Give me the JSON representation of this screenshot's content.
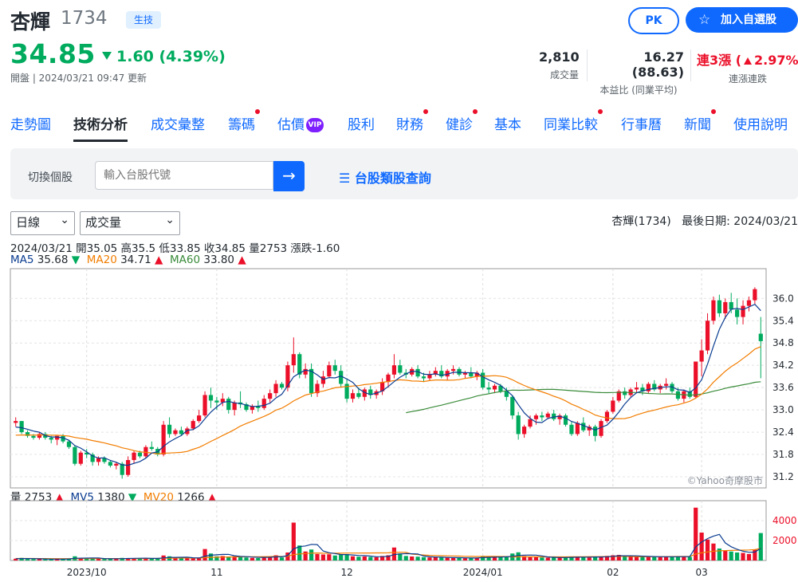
{
  "header": {
    "name": "杏輝",
    "code": "1734",
    "industry": "生技",
    "price": "34.85",
    "change": "1.60 (4.39%)",
    "market_time": "開盤 | 2024/03/21 09:47 更新",
    "pk_label": "PK",
    "watchlist_label": "加入自選股"
  },
  "stats": [
    {
      "value": "2,810",
      "label": "成交量"
    },
    {
      "value": "16.27 (88.63)",
      "label": "本益比 (同業平均)"
    },
    {
      "value_prefix": "連3漲 (",
      "value_pct": "2.97%)",
      "label": "連漲連跌"
    }
  ],
  "tabs": [
    {
      "label": "走勢圖"
    },
    {
      "label": "技術分析",
      "active": true
    },
    {
      "label": "成交彙整"
    },
    {
      "label": "籌碼",
      "dot": true
    },
    {
      "label": "估價",
      "vip": "VIP"
    },
    {
      "label": "股利"
    },
    {
      "label": "財務",
      "dot": true
    },
    {
      "label": "健診",
      "dot": true
    },
    {
      "label": "基本"
    },
    {
      "label": "同業比較",
      "dot": true
    },
    {
      "label": "行事曆"
    },
    {
      "label": "新聞",
      "dot": true
    },
    {
      "label": "使用說明"
    }
  ],
  "switcher": {
    "label": "切換個股",
    "placeholder": "輸入台股代號",
    "category_link": "台股類股查詢"
  },
  "controls": {
    "period": "日線",
    "indicator": "成交量",
    "stock_label": "杏輝(1734)",
    "last_date_label": "最後日期: 2024/03/21"
  },
  "ohlc_line": "2024/03/21 開35.05 高35.5 低33.85 收34.85 量2753 漲跌-1.60",
  "ma": {
    "ma5_label": "MA5",
    "ma5_value": "35.68",
    "ma20_label": "MA20",
    "ma20_value": "34.71",
    "ma60_label": "MA60",
    "ma60_value": "33.80"
  },
  "vol_legend": {
    "vol_label": "量",
    "vol_value": "2753",
    "mv5_label": "MV5",
    "mv5_value": "1380",
    "mv20_label": "MV20",
    "mv20_value": "1266"
  },
  "watermark": "©Yahoo奇摩股市",
  "colors": {
    "up": "#eb0f29",
    "down": "#00ab5e",
    "accent": "#0f69ff",
    "ma5": "#0b3d91",
    "ma20": "#f27d00",
    "ma60": "#3a8b3a"
  },
  "chart_data": {
    "type": "candlestick",
    "price_axis_ticks": [
      36.0,
      35.4,
      34.8,
      34.2,
      33.6,
      33.0,
      32.4,
      31.8,
      31.2
    ],
    "volume_axis_ticks": [
      4000,
      2000
    ],
    "x_labels": [
      "2023/10",
      "11",
      "12",
      "2024/01",
      "02",
      "03"
    ],
    "ylim": [
      30.9,
      36.8
    ],
    "vol_ylim": [
      0,
      6000
    ],
    "candles": [
      [
        32.65,
        32.8,
        32.55,
        32.7,
        180
      ],
      [
        32.7,
        32.7,
        32.35,
        32.4,
        260
      ],
      [
        32.4,
        32.45,
        32.25,
        32.3,
        150
      ],
      [
        32.3,
        32.35,
        32.2,
        32.25,
        140
      ],
      [
        32.25,
        32.4,
        32.2,
        32.35,
        120
      ],
      [
        32.35,
        32.4,
        32.2,
        32.25,
        110
      ],
      [
        32.25,
        32.3,
        32.1,
        32.2,
        160
      ],
      [
        32.2,
        32.3,
        32.05,
        32.3,
        140
      ],
      [
        32.3,
        32.35,
        32.1,
        32.15,
        150
      ],
      [
        32.15,
        32.2,
        31.95,
        32.0,
        200
      ],
      [
        32.0,
        32.05,
        31.5,
        31.55,
        420
      ],
      [
        31.55,
        31.9,
        31.5,
        31.85,
        260
      ],
      [
        31.85,
        31.95,
        31.7,
        31.8,
        180
      ],
      [
        31.8,
        31.85,
        31.5,
        31.6,
        220
      ],
      [
        31.6,
        31.75,
        31.5,
        31.7,
        160
      ],
      [
        31.7,
        31.75,
        31.55,
        31.6,
        150
      ],
      [
        31.6,
        31.65,
        31.45,
        31.5,
        170
      ],
      [
        31.5,
        31.6,
        31.4,
        31.55,
        190
      ],
      [
        31.55,
        31.6,
        31.15,
        31.25,
        260
      ],
      [
        31.25,
        31.75,
        31.2,
        31.65,
        240
      ],
      [
        31.65,
        31.9,
        31.55,
        31.85,
        230
      ],
      [
        31.85,
        31.9,
        31.7,
        31.75,
        200
      ],
      [
        31.75,
        32.05,
        31.7,
        32.0,
        210
      ],
      [
        32.0,
        32.15,
        31.9,
        31.95,
        180
      ],
      [
        31.95,
        32.0,
        31.75,
        31.8,
        200
      ],
      [
        31.8,
        32.7,
        31.75,
        32.6,
        500
      ],
      [
        32.6,
        32.8,
        32.25,
        32.35,
        420
      ],
      [
        32.35,
        32.5,
        32.3,
        32.45,
        260
      ],
      [
        32.45,
        32.55,
        32.3,
        32.35,
        230
      ],
      [
        32.35,
        32.55,
        32.3,
        32.5,
        220
      ],
      [
        32.5,
        32.75,
        32.45,
        32.7,
        250
      ],
      [
        32.7,
        33.0,
        32.65,
        32.85,
        300
      ],
      [
        32.85,
        33.5,
        32.8,
        33.4,
        1150
      ],
      [
        33.4,
        33.6,
        33.05,
        33.25,
        700
      ],
      [
        33.25,
        33.35,
        33.0,
        33.2,
        420
      ],
      [
        33.2,
        33.45,
        33.1,
        33.3,
        450
      ],
      [
        33.3,
        33.35,
        32.9,
        33.0,
        360
      ],
      [
        33.0,
        33.25,
        32.85,
        33.2,
        420
      ],
      [
        33.2,
        33.5,
        33.05,
        33.15,
        380
      ],
      [
        33.15,
        33.2,
        32.95,
        33.0,
        300
      ],
      [
        33.0,
        33.15,
        32.9,
        33.1,
        260
      ],
      [
        33.1,
        33.25,
        32.95,
        33.05,
        240
      ],
      [
        33.05,
        33.4,
        33.0,
        33.3,
        380
      ],
      [
        33.3,
        33.55,
        33.2,
        33.45,
        420
      ],
      [
        33.45,
        33.8,
        33.35,
        33.7,
        520
      ],
      [
        33.7,
        33.75,
        33.55,
        33.6,
        300
      ],
      [
        33.6,
        34.3,
        33.5,
        34.2,
        800
      ],
      [
        34.2,
        34.95,
        34.0,
        34.5,
        3800
      ],
      [
        34.5,
        34.55,
        33.85,
        33.95,
        1500
      ],
      [
        33.95,
        34.25,
        33.85,
        34.1,
        900
      ],
      [
        34.1,
        34.25,
        33.35,
        33.45,
        1100
      ],
      [
        33.45,
        33.8,
        33.35,
        33.7,
        650
      ],
      [
        33.7,
        34.05,
        33.6,
        33.9,
        600
      ],
      [
        33.9,
        34.3,
        33.85,
        34.2,
        620
      ],
      [
        34.2,
        34.35,
        33.95,
        34.05,
        500
      ],
      [
        34.05,
        34.2,
        33.6,
        33.7,
        580
      ],
      [
        33.7,
        33.85,
        33.2,
        33.3,
        640
      ],
      [
        33.3,
        33.55,
        33.2,
        33.45,
        420
      ],
      [
        33.45,
        33.6,
        33.3,
        33.35,
        380
      ],
      [
        33.35,
        33.6,
        33.25,
        33.55,
        400
      ],
      [
        33.55,
        33.65,
        33.3,
        33.4,
        350
      ],
      [
        33.4,
        33.55,
        33.3,
        33.5,
        330
      ],
      [
        33.5,
        33.85,
        33.4,
        33.75,
        450
      ],
      [
        33.75,
        34.0,
        33.6,
        33.95,
        520
      ],
      [
        33.95,
        34.5,
        33.85,
        34.2,
        1300
      ],
      [
        34.2,
        34.35,
        33.95,
        34.0,
        700
      ],
      [
        34.0,
        34.1,
        33.85,
        33.95,
        450
      ],
      [
        33.95,
        34.15,
        33.9,
        34.1,
        400
      ],
      [
        34.1,
        34.2,
        33.85,
        33.9,
        380
      ],
      [
        33.9,
        34.0,
        33.75,
        33.85,
        330
      ],
      [
        33.85,
        34.05,
        33.8,
        33.95,
        300
      ],
      [
        33.95,
        34.15,
        33.9,
        34.05,
        320
      ],
      [
        34.05,
        34.2,
        33.85,
        33.9,
        300
      ],
      [
        33.9,
        34.1,
        33.8,
        34.05,
        280
      ],
      [
        34.05,
        34.2,
        33.95,
        34.1,
        260
      ],
      [
        34.1,
        34.15,
        33.9,
        33.95,
        240
      ],
      [
        33.95,
        34.05,
        33.85,
        34.0,
        230
      ],
      [
        34.0,
        34.15,
        33.85,
        33.9,
        250
      ],
      [
        33.9,
        34.05,
        33.8,
        34.0,
        260
      ],
      [
        34.0,
        34.1,
        33.55,
        33.6,
        450
      ],
      [
        33.6,
        33.75,
        33.45,
        33.55,
        380
      ],
      [
        33.55,
        33.7,
        33.45,
        33.65,
        300
      ],
      [
        33.65,
        33.7,
        33.45,
        33.5,
        320
      ],
      [
        33.5,
        33.6,
        33.25,
        33.35,
        380
      ],
      [
        33.35,
        33.4,
        32.75,
        32.85,
        700
      ],
      [
        32.85,
        32.95,
        32.2,
        32.35,
        820
      ],
      [
        32.35,
        32.6,
        32.25,
        32.55,
        450
      ],
      [
        32.55,
        32.85,
        32.5,
        32.75,
        380
      ],
      [
        32.75,
        32.9,
        32.6,
        32.85,
        330
      ],
      [
        32.85,
        32.95,
        32.7,
        32.8,
        300
      ],
      [
        32.8,
        32.95,
        32.75,
        32.9,
        280
      ],
      [
        32.9,
        33.0,
        32.7,
        32.75,
        300
      ],
      [
        32.75,
        32.9,
        32.6,
        32.85,
        280
      ],
      [
        32.85,
        32.9,
        32.55,
        32.6,
        320
      ],
      [
        32.6,
        32.7,
        32.3,
        32.35,
        400
      ],
      [
        32.35,
        32.7,
        32.3,
        32.65,
        350
      ],
      [
        32.65,
        32.8,
        32.4,
        32.45,
        330
      ],
      [
        32.45,
        32.6,
        32.3,
        32.55,
        300
      ],
      [
        32.55,
        32.6,
        32.15,
        32.3,
        380
      ],
      [
        32.3,
        32.75,
        32.25,
        32.7,
        420
      ],
      [
        32.7,
        33.0,
        32.65,
        32.95,
        460
      ],
      [
        32.95,
        33.35,
        32.9,
        33.25,
        520
      ],
      [
        33.25,
        33.55,
        33.2,
        33.5,
        560
      ],
      [
        33.5,
        33.6,
        33.3,
        33.4,
        420
      ],
      [
        33.4,
        33.6,
        33.35,
        33.55,
        400
      ],
      [
        33.55,
        33.75,
        33.45,
        33.6,
        420
      ],
      [
        33.6,
        33.7,
        33.4,
        33.5,
        380
      ],
      [
        33.5,
        33.75,
        33.45,
        33.7,
        400
      ],
      [
        33.7,
        33.8,
        33.5,
        33.55,
        360
      ],
      [
        33.55,
        33.7,
        33.45,
        33.65,
        340
      ],
      [
        33.65,
        33.85,
        33.55,
        33.7,
        400
      ],
      [
        33.7,
        33.75,
        33.45,
        33.5,
        380
      ],
      [
        33.5,
        33.6,
        33.25,
        33.3,
        420
      ],
      [
        33.3,
        33.55,
        33.2,
        33.5,
        380
      ],
      [
        33.5,
        33.6,
        33.3,
        33.35,
        360
      ],
      [
        33.35,
        34.3,
        33.3,
        34.3,
        5300
      ],
      [
        34.3,
        34.9,
        33.9,
        34.6,
        2800
      ],
      [
        34.6,
        35.6,
        34.5,
        35.4,
        2100
      ],
      [
        35.4,
        36.05,
        35.3,
        35.95,
        1700
      ],
      [
        35.95,
        36.1,
        35.5,
        35.6,
        1200
      ],
      [
        35.6,
        36.0,
        35.45,
        35.9,
        1000
      ],
      [
        35.9,
        36.15,
        35.6,
        35.7,
        900
      ],
      [
        35.7,
        36.0,
        35.3,
        35.5,
        800
      ],
      [
        35.5,
        35.95,
        35.3,
        35.8,
        760
      ],
      [
        35.8,
        36.05,
        35.65,
        35.95,
        650
      ],
      [
        35.95,
        36.3,
        35.85,
        36.25,
        1100
      ],
      [
        35.05,
        35.5,
        33.85,
        34.85,
        2753
      ]
    ]
  }
}
